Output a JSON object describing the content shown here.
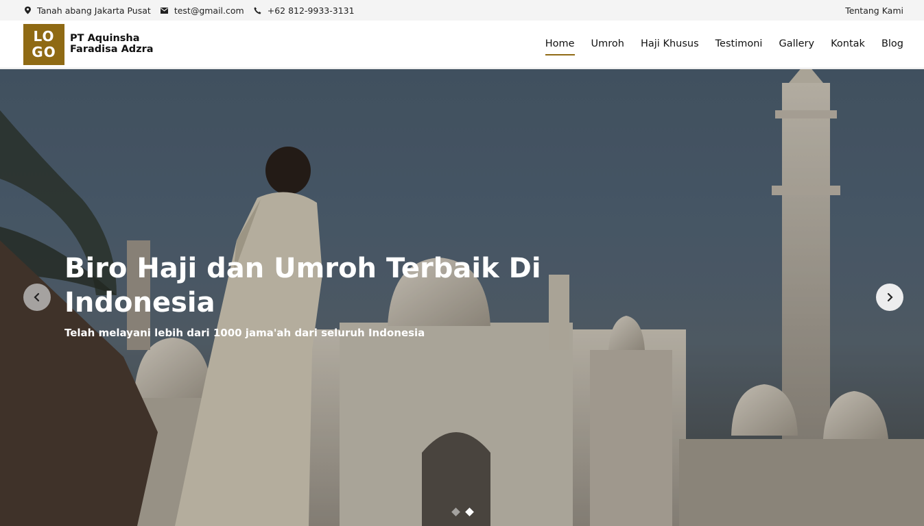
{
  "topbar": {
    "address": "Tanah abang Jakarta Pusat",
    "email": "test@gmail.com",
    "phone": "+62 812-9933-3131",
    "about_link": "Tentang Kami"
  },
  "header": {
    "logo_line1": "LO",
    "logo_line2": "GO",
    "brand_line1": "PT Aquinsha",
    "brand_line2": "Faradisa Adzra",
    "accent_color": "#8f6a14",
    "nav": [
      {
        "label": "Home",
        "active": true
      },
      {
        "label": "Umroh",
        "active": false
      },
      {
        "label": "Haji Khusus",
        "active": false
      },
      {
        "label": "Testimoni",
        "active": false
      },
      {
        "label": "Gallery",
        "active": false
      },
      {
        "label": "Kontak",
        "active": false
      },
      {
        "label": "Blog",
        "active": false
      }
    ]
  },
  "hero": {
    "title": "Biro Haji dan Umroh Terbaik Di Indonesia",
    "subtitle": "Telah melayani lebih dari 1000 jama'ah dari seluruh Indonesia",
    "prev_icon": "chevron-left-icon",
    "next_icon": "chevron-right-icon",
    "slides_count": 2,
    "active_slide": 2
  }
}
